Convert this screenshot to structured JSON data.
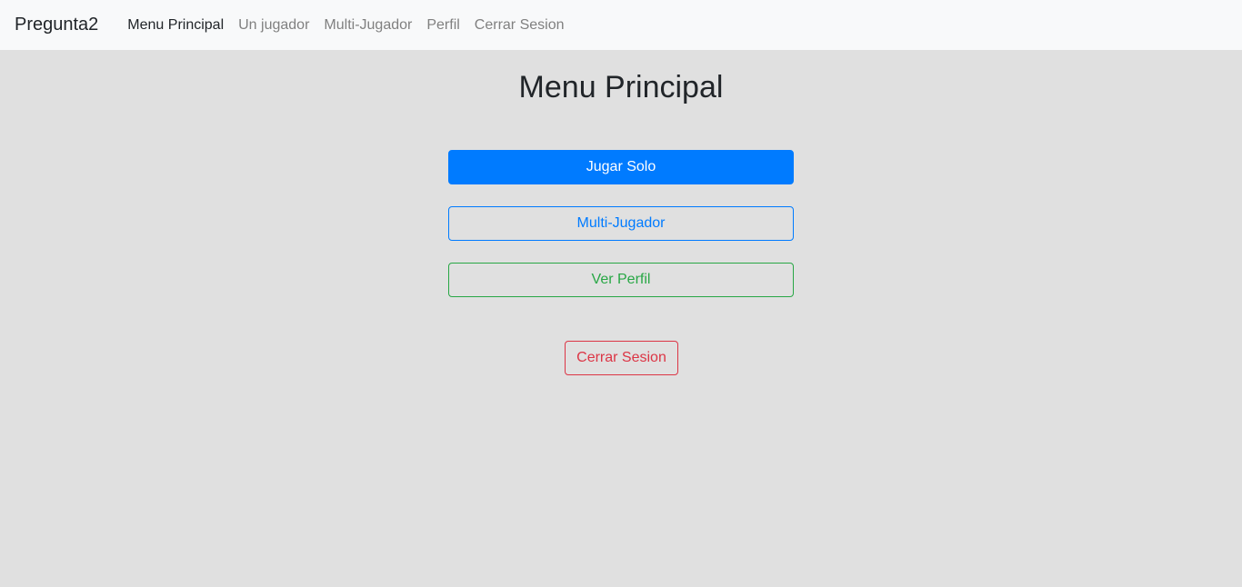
{
  "navbar": {
    "brand": "Pregunta2",
    "links": [
      {
        "label": "Menu Principal",
        "active": true
      },
      {
        "label": "Un jugador",
        "active": false
      },
      {
        "label": "Multi-Jugador",
        "active": false
      },
      {
        "label": "Perfil",
        "active": false
      },
      {
        "label": "Cerrar Sesion",
        "active": false
      }
    ]
  },
  "main": {
    "title": "Menu Principal",
    "buttons": {
      "play_solo": "Jugar Solo",
      "multiplayer": "Multi-Jugador",
      "view_profile": "Ver Perfil",
      "logout": "Cerrar Sesion"
    }
  },
  "colors": {
    "primary": "#007bff",
    "success": "#28a745",
    "danger": "#dc3545",
    "navbar_bg": "#f8f9fa",
    "page_bg": "#e0e0e0"
  }
}
